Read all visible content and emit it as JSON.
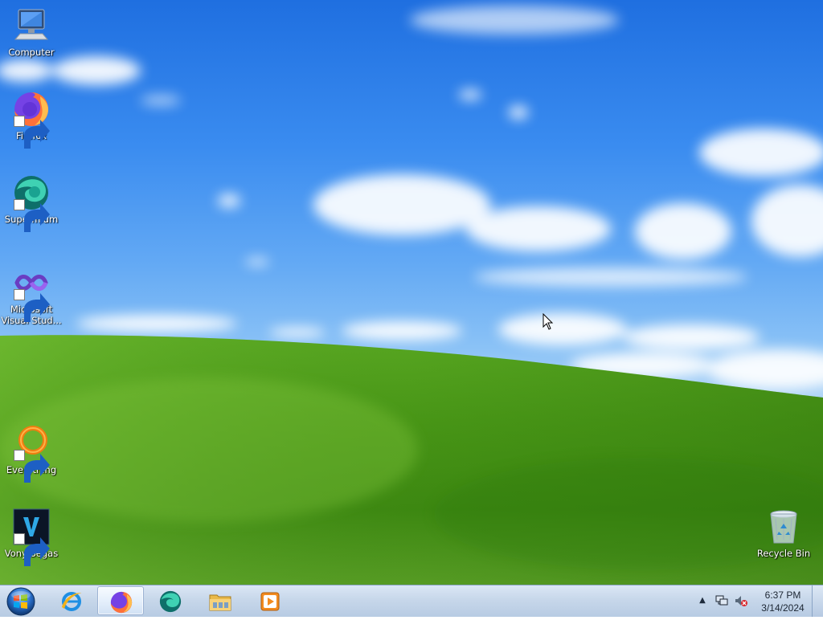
{
  "desktop": {
    "icons": [
      {
        "label": "Computer",
        "icon": "computer-icon",
        "shortcut": false
      },
      {
        "label": "Firefox",
        "icon": "firefox-icon",
        "shortcut": true
      },
      {
        "label": "Supermium",
        "icon": "supermium-icon",
        "shortcut": true
      },
      {
        "label": "Microsoft Visual Stud...",
        "icon": "visual-studio-icon",
        "shortcut": true
      },
      {
        "label": "Everything",
        "icon": "everything-icon",
        "shortcut": true
      },
      {
        "label": "Vony Segas",
        "icon": "vony-segas-icon",
        "shortcut": true
      },
      {
        "label": "Recycle Bin",
        "icon": "recycle-bin-icon",
        "shortcut": false
      }
    ]
  },
  "taskbar": {
    "start": {
      "icon": "windows-start-orb-icon"
    },
    "pinned": [
      {
        "icon": "internet-explorer-icon",
        "active": false
      },
      {
        "icon": "firefox-icon",
        "active": true
      },
      {
        "icon": "supermium-icon",
        "active": false
      },
      {
        "icon": "file-explorer-icon",
        "active": false
      },
      {
        "icon": "media-player-icon",
        "active": false
      }
    ],
    "tray": {
      "chevron": "▲",
      "network_icon": "network-icon",
      "volume_icon": "volume-muted-icon",
      "time": "6:37 PM",
      "date": "3/14/2024"
    }
  },
  "colors": {
    "sky_top": "#1f6fe0",
    "grass": "#4e9a1c",
    "taskbar": "#c7d7ea",
    "clock_text": "#1c2633"
  }
}
